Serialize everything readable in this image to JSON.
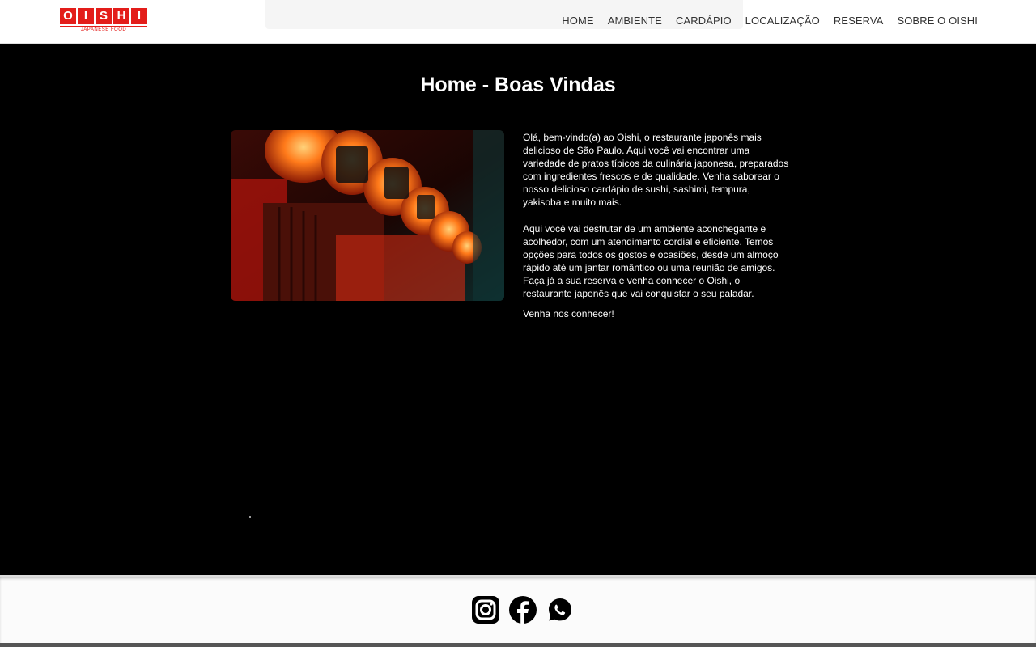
{
  "brand": {
    "logo_text": "OISHI",
    "logo_letters": [
      "O",
      "I",
      "S",
      "H",
      "I"
    ],
    "tagline": "JAPANESE FOOD",
    "accent_color": "#e31d1a"
  },
  "nav": {
    "items": [
      {
        "label": "HOME"
      },
      {
        "label": "AMBIENTE"
      },
      {
        "label": "CARDÁPIO"
      },
      {
        "label": "LOCALIZAÇÃO"
      },
      {
        "label": "RESERVA"
      },
      {
        "label": "SOBRE O OISHI"
      }
    ]
  },
  "main": {
    "title": "Home - Boas Vindas",
    "paragraphs": [
      "Olá, bem-vindo(a) ao Oishi, o restaurante japonês mais delicioso de São Paulo. Aqui você vai encontrar uma variedade de pratos típicos da culinária japonesa, preparados com ingredientes frescos e de qualidade. Venha saborear o nosso delicioso cardápio de sushi, sashimi, tempura, yakisoba e muito mais.",
      "Aqui você vai desfrutar de um ambiente aconchegante e acolhedor, com um atendimento cordial e eficiente. Temos opções para todos os gostos e ocasiões, desde um almoço rápido até um jantar romântico ou uma reunião de amigos. Faça já a sua reserva e venha conhecer o Oishi, o restaurante japonês que vai conquistar o seu paladar.",
      "Venha nos conhecer!"
    ]
  },
  "footer": {
    "icons": [
      "instagram-icon",
      "facebook-icon",
      "whatsapp-icon"
    ]
  }
}
